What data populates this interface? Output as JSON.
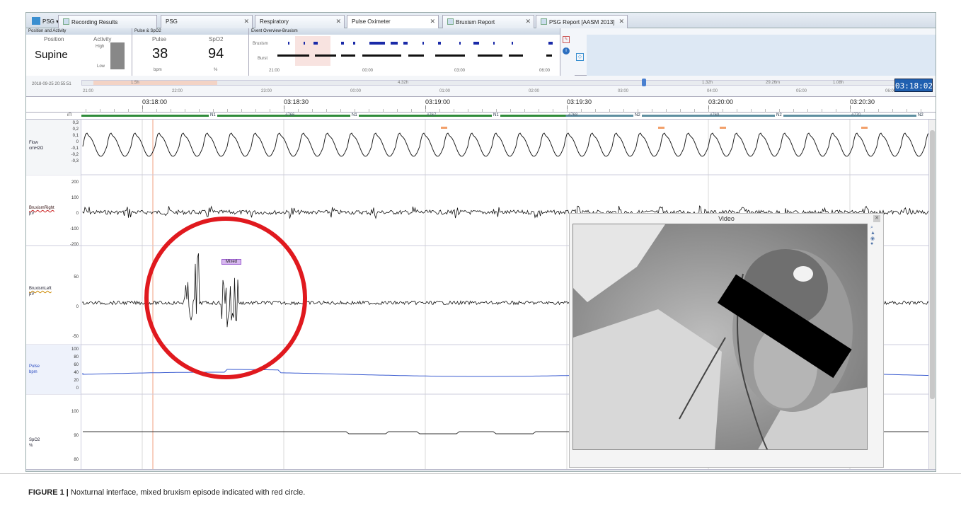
{
  "tabs": {
    "app_button": "PSG",
    "items": [
      {
        "label": "Recording Results"
      },
      {
        "label": "PSG"
      },
      {
        "label": "Respiratory"
      },
      {
        "label": "Pulse Oximeter"
      },
      {
        "label": "Bruxism Report"
      },
      {
        "label": "PSG Report [AASM 2013]"
      }
    ]
  },
  "panels": {
    "position_activity": {
      "header": "Position and Activity",
      "position_label": "Position",
      "activity_label": "Activity",
      "position_value": "Supine",
      "activity_high": "High",
      "activity_low": "Low"
    },
    "pulse_spo2": {
      "header": "Pulse & SpO2",
      "pulse_label": "Pulse",
      "spo2_label": "SpO2",
      "pulse_value": "38",
      "spo2_value": "94",
      "pulse_unit": "bpm",
      "spo2_unit": "%"
    },
    "event_overview": {
      "header": "Event Overview-Bruxism",
      "row1": "Bruxism",
      "row2": "Burst",
      "times": [
        "21:00",
        "00:00",
        "03:00",
        "06:00"
      ]
    }
  },
  "timeline": {
    "start": "2018-09-25 20:55:51",
    "hours": [
      "21:00",
      "22:00",
      "23:00",
      "00:00",
      "01:00",
      "02:00",
      "03:00",
      "04:00",
      "05:00",
      "06:00"
    ],
    "zooms": [
      "1.5h",
      "4.32h",
      "1.32h",
      "29.26m",
      "1.08h"
    ],
    "clock": "03:18:02"
  },
  "timescale": {
    "labels": [
      "03:18:00",
      "03:18:30",
      "03:19:00",
      "03:19:30",
      "03:20:00",
      "03:20:30"
    ],
    "epochs": [
      "766",
      "767",
      "768",
      "769",
      "770"
    ],
    "stages": [
      "N1",
      "N1",
      "N1",
      "N2",
      "N2",
      "N2"
    ]
  },
  "channels": {
    "flow": {
      "name": "Flow",
      "unit": "cmH2O",
      "ticks": [
        "0,3",
        "0,2",
        "0,1",
        "0",
        "-0,1",
        "-0,2",
        "-0,3"
      ]
    },
    "brux_right": {
      "name": "BruxismRight",
      "unit": "µV",
      "ticks": [
        "200",
        "100",
        "0",
        "-100",
        "-200"
      ]
    },
    "brux_left": {
      "name": "BruxismLeft",
      "unit": "µV",
      "ticks": [
        "50",
        "0",
        "-50"
      ]
    },
    "pulse": {
      "name": "Pulse",
      "unit": "bpm",
      "ticks": [
        "100",
        "80",
        "60",
        "40",
        "20",
        "0"
      ]
    },
    "spo2": {
      "name": "SpO2",
      "unit": "%",
      "ticks": [
        "100",
        "90",
        "80"
      ]
    }
  },
  "event_label": "Mixed",
  "video": {
    "title": "Video"
  },
  "caption": {
    "bold": "FIGURE 1 |",
    "text": " Noxturnal interface, mixed bruxism episode indicated with red circle."
  }
}
